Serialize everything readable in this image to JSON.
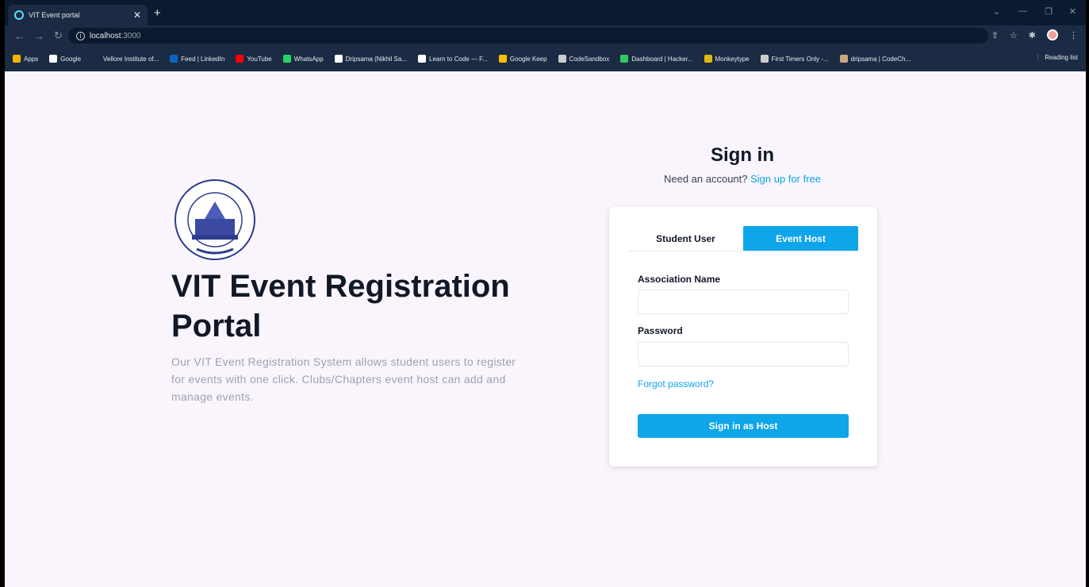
{
  "browser": {
    "tab_title": "VIT Event portal",
    "url_host": "localhost",
    "url_port": ":3000",
    "bookmarks": [
      {
        "label": "Apps",
        "icon": "apps-grid-icon",
        "color": "#f4b400"
      },
      {
        "label": "Google",
        "icon": "google-icon",
        "color": "#ffffff"
      },
      {
        "label": "Vellore Institute of...",
        "icon": "vit-icon",
        "color": "#1b2b44"
      },
      {
        "label": "Feed | LinkedIn",
        "icon": "linkedin-icon",
        "color": "#0a66c2"
      },
      {
        "label": "YouTube",
        "icon": "youtube-icon",
        "color": "#ff0000"
      },
      {
        "label": "WhatsApp",
        "icon": "whatsapp-icon",
        "color": "#25d366"
      },
      {
        "label": "Dripsama (Nikhil Sa...",
        "icon": "github-icon",
        "color": "#ffffff"
      },
      {
        "label": "Learn to Code — F...",
        "icon": "freecodecamp-icon",
        "color": "#ffffff"
      },
      {
        "label": "Google Keep",
        "icon": "keep-icon",
        "color": "#fbbc04"
      },
      {
        "label": "CodeSandbox",
        "icon": "codesandbox-icon",
        "color": "#cccccc"
      },
      {
        "label": "Dashboard | Hacker...",
        "icon": "hackerrank-icon",
        "color": "#2ec866"
      },
      {
        "label": "Monkeytype",
        "icon": "monkeytype-icon",
        "color": "#e2b714"
      },
      {
        "label": "First Timers Only -...",
        "icon": "globe-icon",
        "color": "#cccccc"
      },
      {
        "label": "dripsama | CodeCh...",
        "icon": "codechef-icon",
        "color": "#c9a77c"
      }
    ],
    "reading_list": "Reading list"
  },
  "hero": {
    "title": "VIT Event Registration Portal",
    "description": "Our VIT Event Registration System allows student users to register for events with one click. Clubs/Chapters event host can add and manage events."
  },
  "signin": {
    "title": "Sign in",
    "prompt": "Need an account?",
    "signup_link": "Sign up for free",
    "tabs": [
      "Student User",
      "Event Host"
    ],
    "active_tab": "Event Host",
    "association_label": "Association Name",
    "association_value": "",
    "password_label": "Password",
    "password_value": "",
    "forgot": "Forgot password?",
    "submit": "Sign in as Host"
  },
  "colors": {
    "accent": "#0ea5e9",
    "page_bg": "#faf5fd",
    "browser_bg": "#1b2b44"
  }
}
